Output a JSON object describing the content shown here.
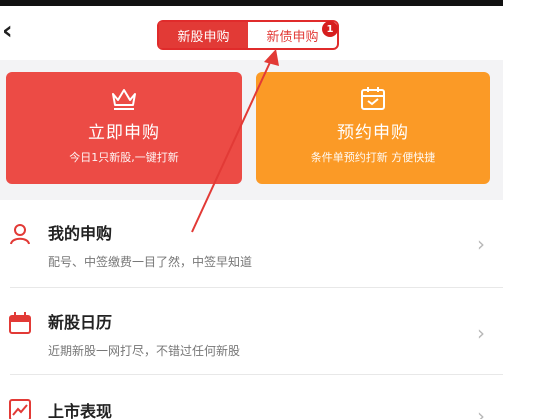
{
  "nav": {
    "back_icon": "chevron-left-icon",
    "tabs": [
      {
        "label": "新股申购",
        "active": false
      },
      {
        "label": "新债申购",
        "active": true,
        "badge": "1"
      }
    ]
  },
  "cards": [
    {
      "title": "立即申购",
      "subtitle": "今日1只新股,一键打新",
      "icon": "crown-icon",
      "color": "#ec4b45"
    },
    {
      "title": "预约申购",
      "subtitle": "条件单预约打新 方便快捷",
      "icon": "calendar-icon",
      "color": "#fb9a26"
    }
  ],
  "list": [
    {
      "title": "我的申购",
      "subtitle": "配号、中签缴费一目了然，中签早知道",
      "icon": "user-icon"
    },
    {
      "title": "新股日历",
      "subtitle": "近期新股一网打尽，不错过任何新股",
      "icon": "calendar-icon"
    },
    {
      "title": "上市表现",
      "subtitle": "",
      "icon": "trend-chart-icon"
    }
  ],
  "colors": {
    "accent": "#e23a36",
    "orange": "#fb9a26"
  }
}
